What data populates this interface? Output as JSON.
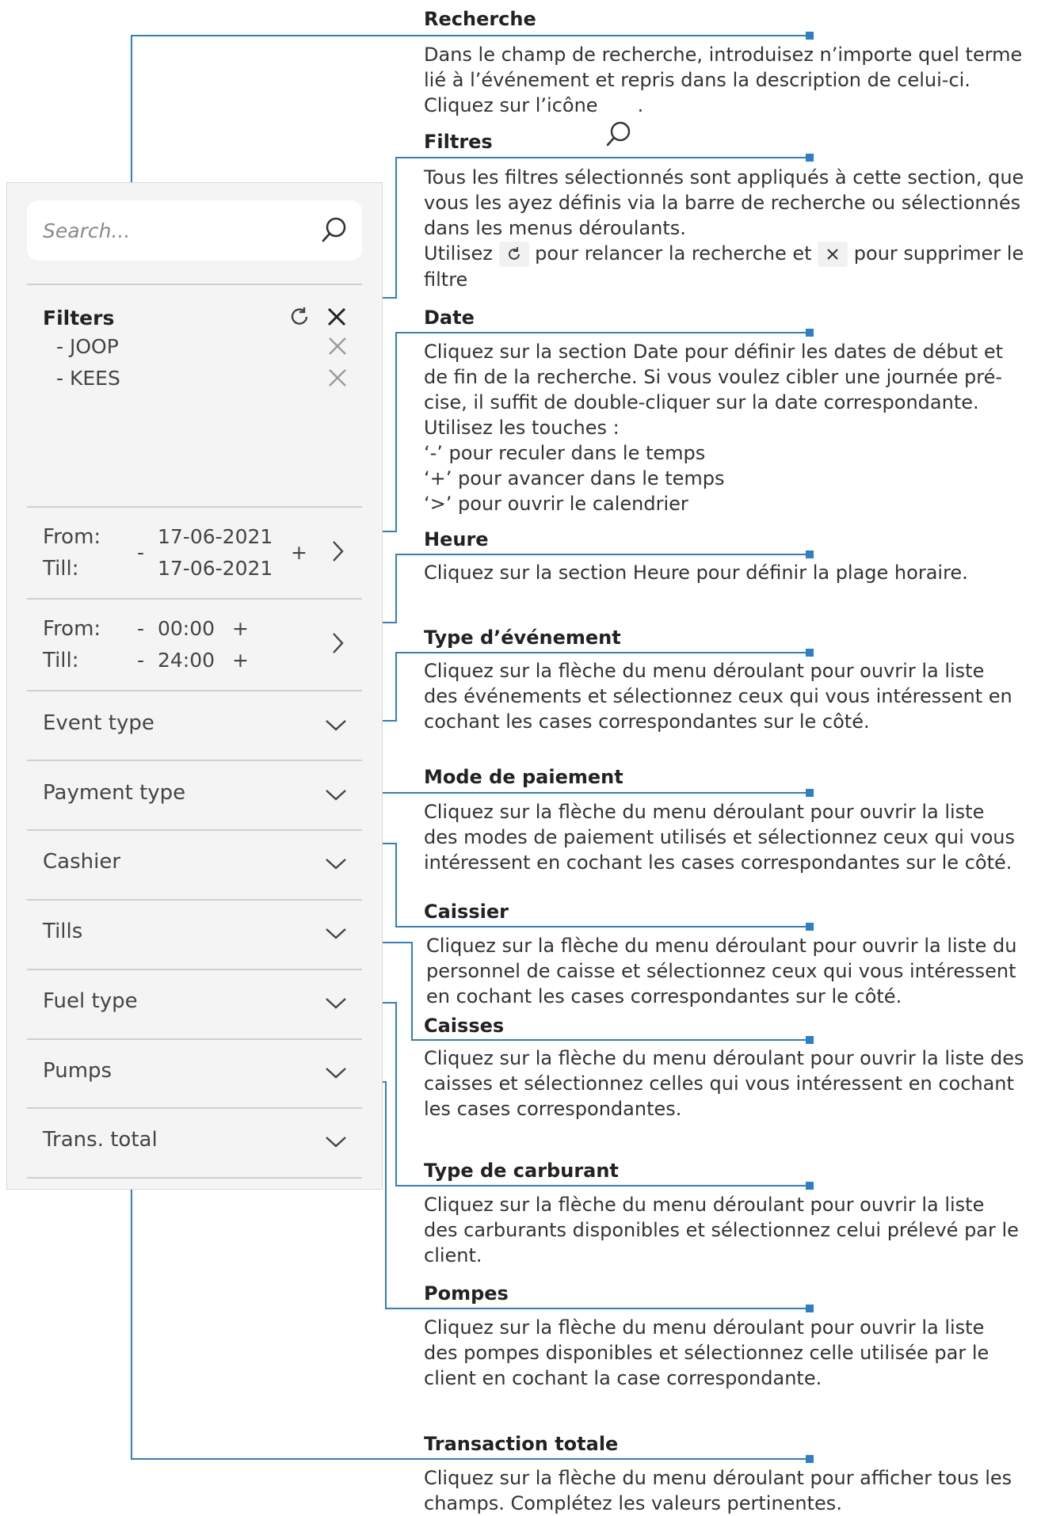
{
  "panel": {
    "search": {
      "placeholder": "Search..."
    },
    "filters": {
      "title": "Filters",
      "items": [
        "- JOOP",
        "- KEES"
      ]
    },
    "date": {
      "from_label": "From:",
      "till_label": "Till:",
      "from_value": "17-06-2021",
      "till_value": "17-06-2021",
      "minus": "-",
      "plus": "+"
    },
    "time": {
      "from_label": "From:",
      "till_label": "Till:",
      "from_value": "00:00",
      "till_value": "24:00",
      "minus": "-",
      "plus": "+"
    },
    "dropdowns": [
      "Event type",
      "Payment type",
      "Cashier",
      "Tills",
      "Fuel type",
      "Pumps",
      "Trans. total"
    ]
  },
  "icons": {
    "search": "search-icon",
    "refresh": "refresh-icon",
    "close": "close-icon",
    "chevron_right": "chevron-right-icon",
    "chevron_down": "chevron-down-icon"
  },
  "colors": {
    "callout_line": "#2e7fc3",
    "panel_bg": "#f4f4f4",
    "separator": "#cfcfcf"
  },
  "annotations": [
    {
      "heading": "Recherche",
      "lines": [
        "Dans le champ de recherche, introduisez n’importe quel terme",
        "lié à l’événement et repris dans la description de celui-ci.",
        "Cliquez sur l’icône"
      ],
      "line3_end": "."
    },
    {
      "heading": "Filtres",
      "lines": [
        "Tous les filtres sélectionnés sont appliqués à cette section, que",
        "vous les ayez définis via la barre de recherche ou sélectionnés",
        "dans les menus déroulants."
      ],
      "use_a": "Utilisez",
      "use_b": "pour relancer la recherche et",
      "use_c": "pour supprimer le",
      "last": "filtre"
    },
    {
      "heading": "Date",
      "lines": [
        "Cliquez sur la section Date pour définir les dates de début et",
        "de fin de la recherche. Si vous voulez cibler une journée pré-",
        "cise, il suffit de double-cliquer sur la date correspondante.",
        "Utilisez les touches :",
        "‘-’ pour reculer dans le temps",
        "‘+’ pour avancer dans le temps",
        "‘>’ pour ouvrir le calendrier"
      ]
    },
    {
      "heading": "Heure",
      "lines": [
        "Cliquez sur la section Heure pour définir la plage horaire."
      ]
    },
    {
      "heading": "Type d’événement",
      "lines": [
        "Cliquez sur la flèche du menu déroulant pour ouvrir la liste",
        "des événements et sélectionnez ceux qui vous intéressent en",
        "cochant les cases correspondantes sur le côté."
      ]
    },
    {
      "heading": "Mode de paiement",
      "lines": [
        "Cliquez sur la flèche du menu déroulant pour ouvrir la liste",
        "des modes de paiement utilisés et sélectionnez ceux qui vous",
        "intéressent en cochant les cases correspondantes sur le côté."
      ]
    },
    {
      "heading": "Caissier",
      "lines": [
        "Cliquez sur la flèche du menu déroulant pour ouvrir la liste du",
        "personnel de caisse et sélectionnez ceux qui vous intéressent",
        "en cochant les cases correspondantes sur le côté."
      ]
    },
    {
      "heading": "Caisses",
      "lines": [
        "Cliquez sur la flèche du menu déroulant pour ouvrir la liste des",
        "caisses et sélectionnez celles qui vous intéressent en cochant",
        "les cases correspondantes."
      ]
    },
    {
      "heading": "Type de carburant",
      "lines": [
        "Cliquez sur la flèche du menu déroulant pour ouvrir la liste",
        "des carburants disponibles et sélectionnez celui prélevé par le",
        "client."
      ]
    },
    {
      "heading": "Pompes",
      "lines": [
        "Cliquez sur la flèche du menu déroulant pour ouvrir la liste",
        "des pompes disponibles et sélectionnez celle utilisée par le",
        "client en cochant la case correspondante."
      ]
    },
    {
      "heading": "Transaction totale",
      "lines": [
        "Cliquez sur la flèche du menu déroulant pour afficher tous les",
        "champs. Complétez les valeurs pertinentes."
      ]
    }
  ]
}
